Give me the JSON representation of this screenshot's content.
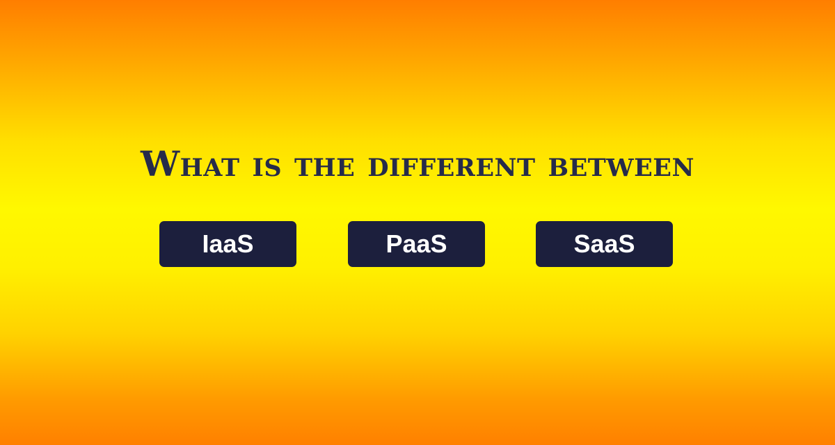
{
  "headline": "What is the different between",
  "buttons": [
    {
      "label": "IaaS"
    },
    {
      "label": "PaaS"
    },
    {
      "label": "SaaS"
    }
  ],
  "colors": {
    "background_top": "#ff7e00",
    "background_middle": "#fff800",
    "background_bottom": "#ff8000",
    "headline_text": "#262b4a",
    "button_fill": "#1c1f3d",
    "button_text": "#ffffff"
  }
}
